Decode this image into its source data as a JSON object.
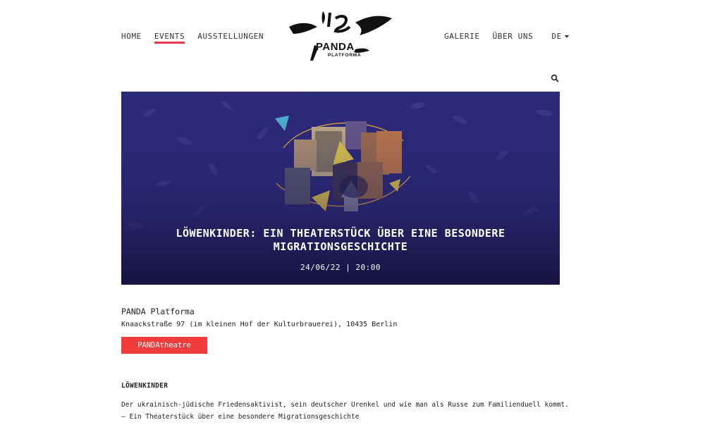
{
  "nav": {
    "left": [
      {
        "label": "HOME",
        "active": false
      },
      {
        "label": "EVENTS",
        "active": true
      },
      {
        "label": "AUSSTELLUNGEN",
        "active": false
      }
    ],
    "right": [
      {
        "label": "GALERIE"
      },
      {
        "label": "ÜBER UNS"
      }
    ],
    "language": "DE"
  },
  "logo": {
    "name": "PANDA",
    "subtitle": "PLATFORMA"
  },
  "icons": {
    "search": "search-icon",
    "language_dropdown": "chevron-down-icon"
  },
  "hero": {
    "title": "LÖWENKINDER: EIN THEATERSTÜCK ÜBER EINE BESONDERE MIGRATIONSGESCHICHTE",
    "date": "24/06/22 | 20:00",
    "background_color": "#2b2877"
  },
  "venue": {
    "name": "PANDA Platforma",
    "address": "Knaackstraße 97 (im kleinen Hof der Kulturbrauerei), 10435 Berlin",
    "tag": "PANDAtheatre"
  },
  "content": {
    "heading": "LÖWENKINDER",
    "description_line1": "Der ukrainisch-jüdische Friedensaktivist, sein deutscher Urenkel und wie man als Russe zum Familienduell kommt.",
    "description_line2": "– Ein Theaterstück über eine besondere Migrationsgeschichte"
  },
  "colors": {
    "accent": "#f23c3c",
    "active_underline": "#e5384a",
    "hero_bg": "#2b2877"
  }
}
